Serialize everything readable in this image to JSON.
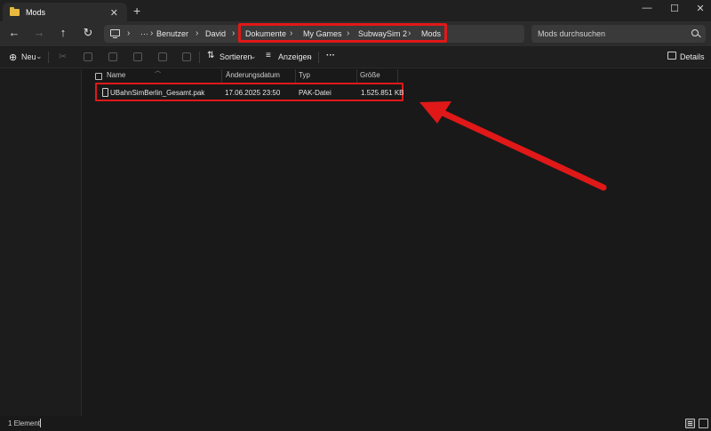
{
  "window": {
    "tab_title": "Mods",
    "new_tab_label": "+",
    "tab_close_label": "✕",
    "minimize_label": "—",
    "maximize_label": "☐",
    "close_label": "✕"
  },
  "nav": {
    "breadcrumb": [
      "Benutzer",
      "David",
      "Dokumente",
      "My Games",
      "SubwaySim 2",
      "Mods"
    ],
    "overflow_label": "···",
    "search_placeholder": "Mods durchsuchen"
  },
  "toolbar": {
    "new_label": "Neu",
    "sort_label": "Sortieren",
    "view_label": "Anzeigen",
    "more_label": "···",
    "details_label": "Details"
  },
  "columns": [
    "Name",
    "Änderungsdatum",
    "Typ",
    "Größe"
  ],
  "files": [
    {
      "name": "UBahnSimBerlin_Gesamt.pak",
      "modified": "17.06.2025 23:50",
      "type": "PAK-Datei",
      "size": "1.525.851 KB"
    }
  ],
  "status": {
    "count": "1 Element"
  },
  "colors": {
    "highlight": "#e01818",
    "folder": "#e8b93e",
    "background": "#191919"
  },
  "icons": [
    "folder-icon",
    "back-icon",
    "forward-icon",
    "up-icon",
    "refresh-icon",
    "computer-icon",
    "search-icon",
    "new-icon",
    "cut-icon",
    "copy-icon",
    "paste-icon",
    "rename-icon",
    "share-icon",
    "delete-icon",
    "sort-icon",
    "view-icon",
    "details-icon",
    "file-icon"
  ]
}
